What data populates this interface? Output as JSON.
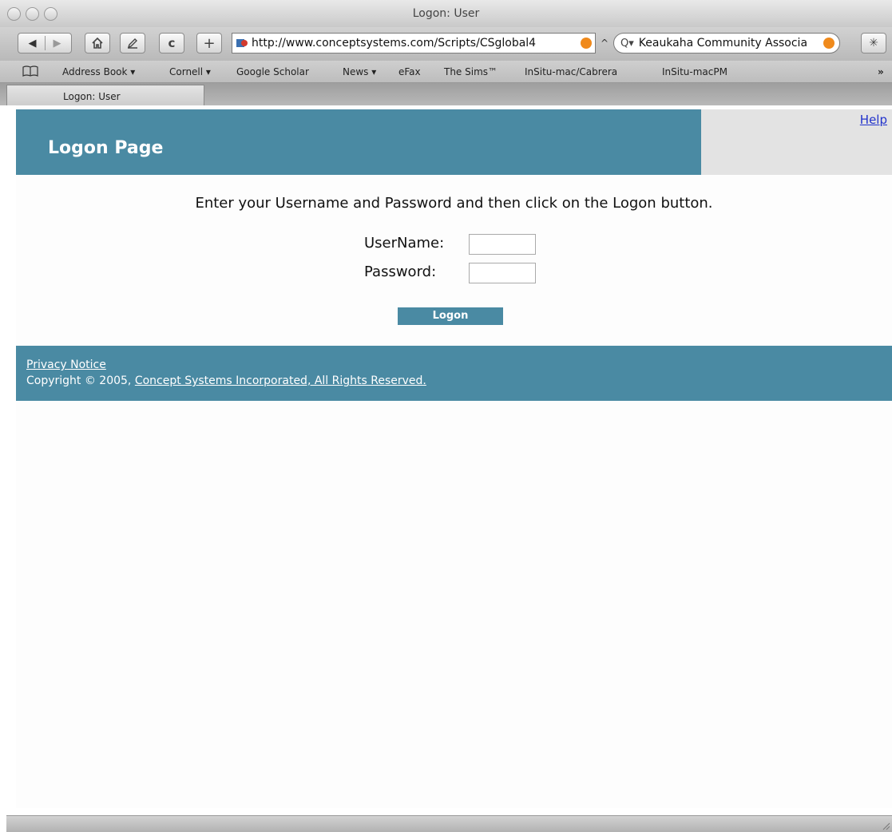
{
  "window": {
    "title": "Logon: User"
  },
  "toolbar": {
    "back_icon": "back-arrow-icon",
    "forward_icon": "forward-arrow-icon",
    "home_icon": "home-icon",
    "edit_icon": "pencil-icon",
    "reload_icon": "reload-icon",
    "add_icon": "plus-icon",
    "url": "http://www.conceptsystems.com/Scripts/CSglobal4",
    "search_value": "Keaukaha Community Associa",
    "bug_icon": "bug-icon"
  },
  "bookmarks": {
    "items": [
      "Address Book ▾",
      "Cornell ▾",
      "Google Scholar",
      "News ▾",
      "eFax",
      "The Sims™",
      "InSitu-mac/Cabrera",
      "InSitu-macPM"
    ],
    "overflow": "»"
  },
  "tabs": {
    "active": "Logon: User"
  },
  "page": {
    "header_title": "Logon Page",
    "help_link": "Help",
    "instructions": "Enter your Username and Password and then click on the Logon button.",
    "username_label": "UserName:",
    "username_value": "",
    "password_label": "Password:",
    "password_value": "",
    "logon_button": "Logon",
    "footer": {
      "privacy_link": "Privacy Notice",
      "copyright_prefix": "Copyright © 2005, ",
      "copyright_link": "Concept Systems Incorporated, All Rights Reserved."
    }
  },
  "colors": {
    "header_bg": "#4a8aa3",
    "help_bg": "#e3e3e3",
    "link": "#2233cc"
  }
}
